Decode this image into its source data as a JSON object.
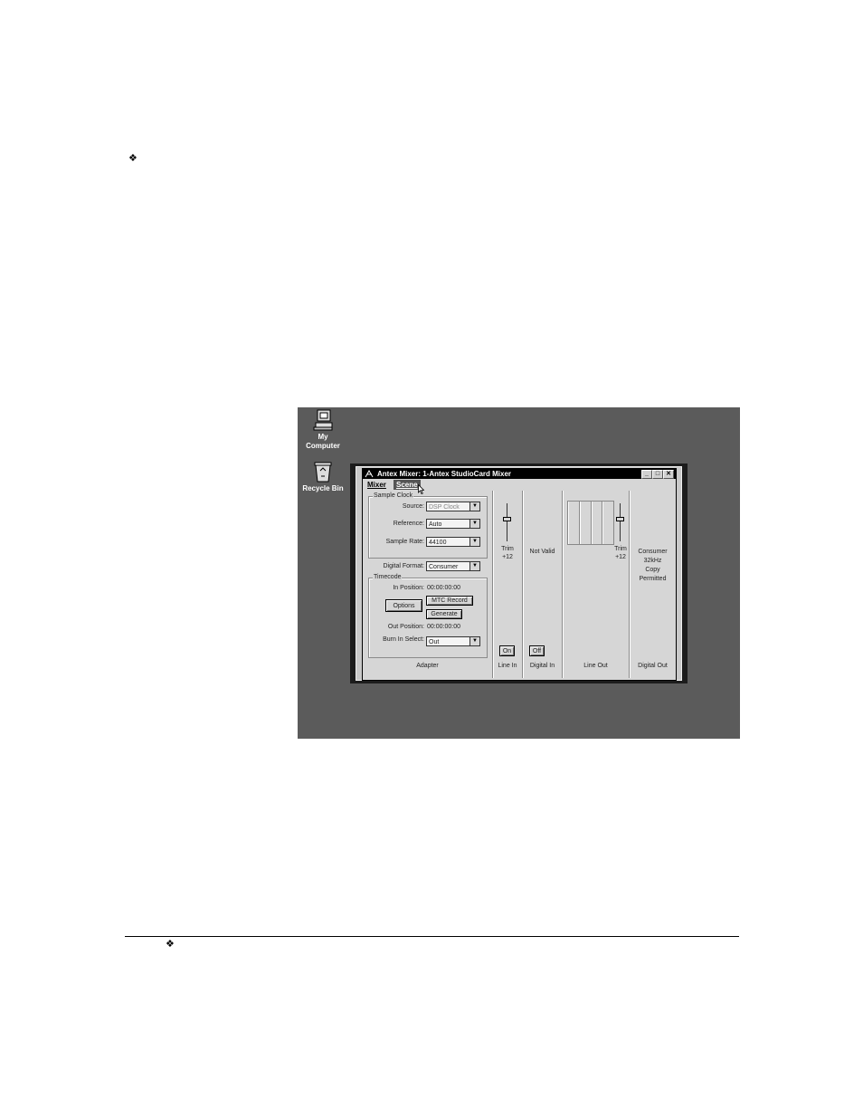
{
  "page": {
    "bullet_glyph": "❖"
  },
  "desktop": {
    "icons": [
      {
        "label_line1": "My",
        "label_line2": "Computer",
        "icon": "computer-icon"
      },
      {
        "label_line1": "Recycle Bin",
        "label_line2": "",
        "icon": "recycle-bin-icon"
      }
    ]
  },
  "window": {
    "title": "Antex Mixer: 1-Antex StudioCard Mixer",
    "controls": {
      "minimize": "_",
      "maximize": "□",
      "close": "✕"
    },
    "menus": [
      {
        "label": "Mixer",
        "active": false
      },
      {
        "label": "Scene",
        "active": true
      }
    ]
  },
  "adapter": {
    "sample_clock": {
      "group_label": "Sample Clock",
      "source_label": "Source:",
      "source_value": "DSP Clock",
      "reference_label": "Reference:",
      "reference_value": "Auto",
      "sample_rate_label": "Sample Rate:",
      "sample_rate_value": "44100"
    },
    "digital_format_label": "Digital Format:",
    "digital_format_value": "Consumer",
    "timecode": {
      "group_label": "Timecode",
      "in_position_label": "In Position:",
      "in_position_value": "00:00:00:00",
      "options_button": "Options",
      "mtc_record_button": "MTC Record",
      "generate_button": "Generate",
      "out_position_label": "Out Position:",
      "out_position_value": "00:00:00:00",
      "burn_in_label": "Burn In Select:",
      "burn_in_value": "Out"
    },
    "column_label": "Adapter"
  },
  "line_in": {
    "trim_label": "Trim",
    "trim_value": "+12",
    "toggle_button": "On",
    "column_label": "Line In"
  },
  "digital_in": {
    "status": "Not Valid",
    "toggle_button": "Off",
    "column_label": "Digital In"
  },
  "line_out": {
    "trim_label": "Trim",
    "trim_value": "+12",
    "column_label": "Line Out"
  },
  "digital_out": {
    "status_line1": "Consumer",
    "status_line2": "32kHz",
    "status_line3": "Copy",
    "status_line4": "Permitted",
    "column_label": "Digital Out"
  }
}
